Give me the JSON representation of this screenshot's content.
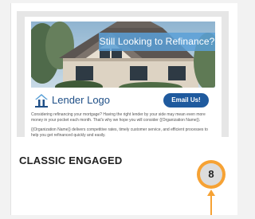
{
  "hero": {
    "headline": "Still Looking to Refinance?"
  },
  "header": {
    "logo_text": "Lender Logo",
    "cta_label": "Email Us!"
  },
  "body": {
    "paragraph_1": "Considering refinancing your mortgage? Having the right lender by your side may mean even more money in your pocket each month. That's why we hope you will consider {{Organization Name}}.",
    "paragraph_2": "{{Organization Name}} delivers competitive rates, timely customer service, and efficient processes to help you get refinanced quickly and easily."
  },
  "template": {
    "name": "CLASSIC ENGAGED",
    "number": "8"
  },
  "colors": {
    "accent": "#f6a234",
    "button": "#1f5a9e",
    "banner": "#5aa0d7"
  },
  "icons": {
    "logo": "house-roof-icon",
    "pointer": "up-arrow-pointer-icon"
  }
}
